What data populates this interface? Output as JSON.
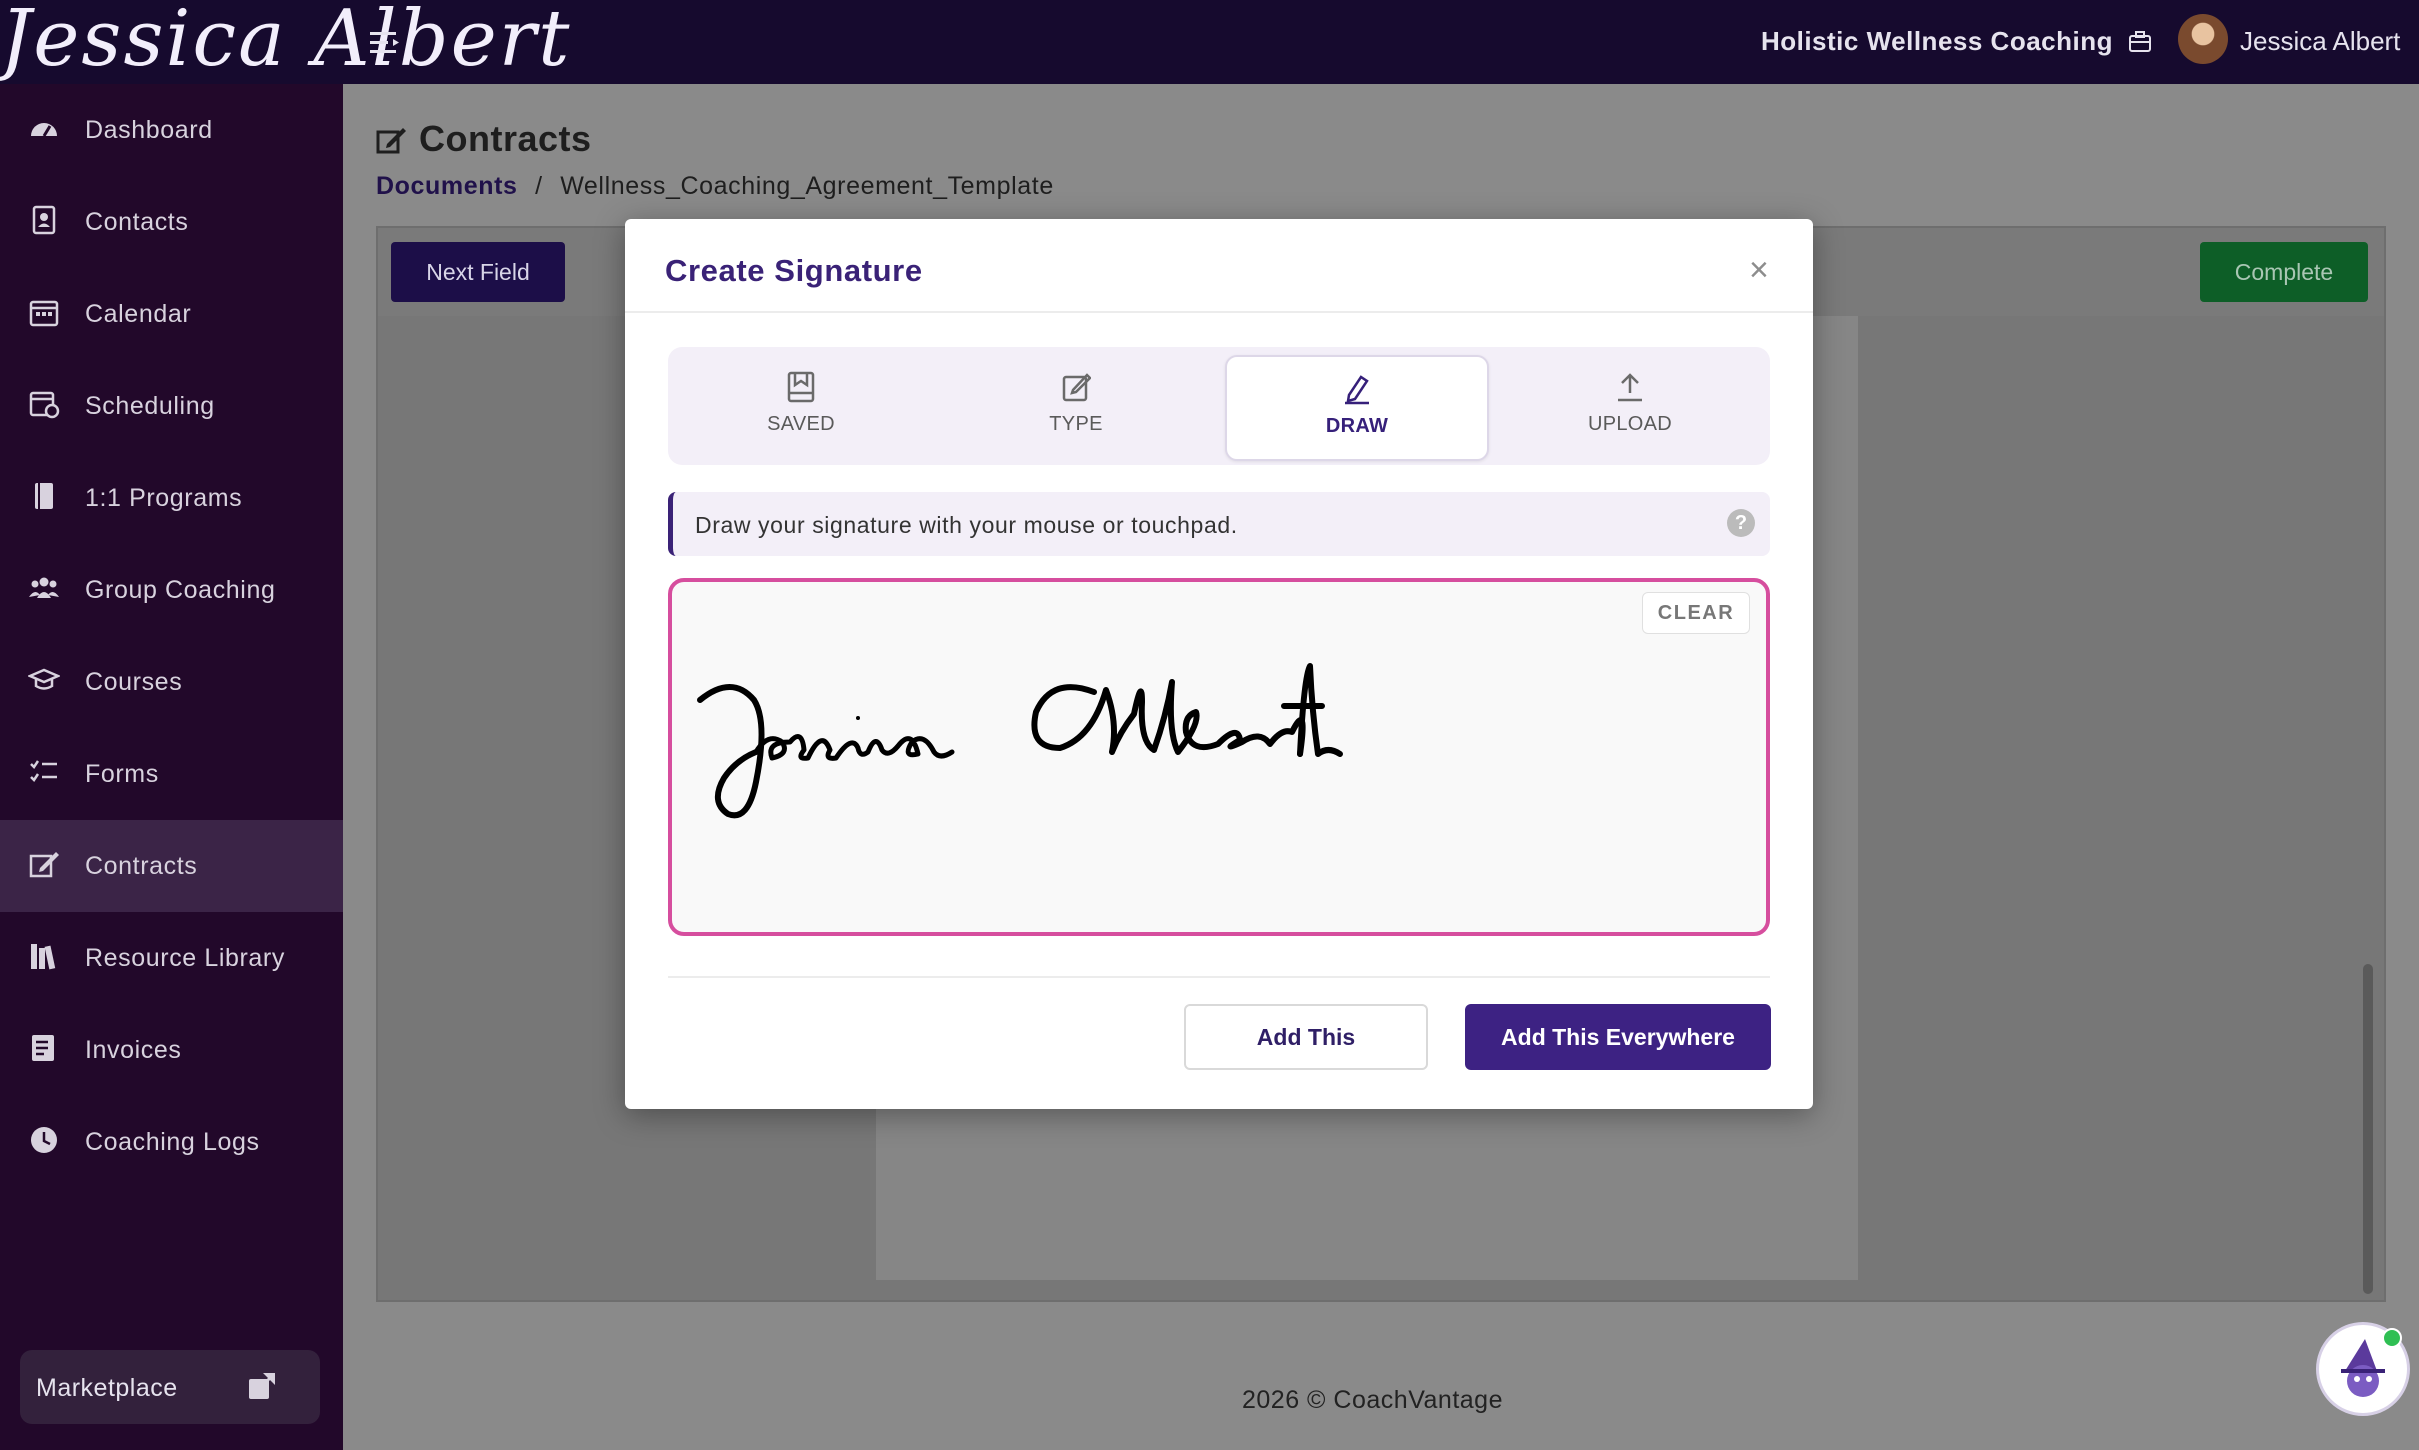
{
  "topbar": {
    "logo": "Jessica Albert",
    "business_name": "Holistic Wellness Coaching",
    "user_name": "Jessica Albert"
  },
  "sidebar": {
    "items": [
      {
        "label": "Dashboard",
        "icon": "dashboard-icon"
      },
      {
        "label": "Contacts",
        "icon": "contacts-icon"
      },
      {
        "label": "Calendar",
        "icon": "calendar-icon"
      },
      {
        "label": "Scheduling",
        "icon": "scheduling-icon"
      },
      {
        "label": "1:1 Programs",
        "icon": "book-icon"
      },
      {
        "label": "Group Coaching",
        "icon": "group-icon"
      },
      {
        "label": "Courses",
        "icon": "graduation-cap-icon"
      },
      {
        "label": "Forms",
        "icon": "list-icon"
      },
      {
        "label": "Contracts",
        "icon": "contract-icon",
        "active": true
      },
      {
        "label": "Resource Library",
        "icon": "library-icon"
      },
      {
        "label": "Invoices",
        "icon": "invoice-icon"
      },
      {
        "label": "Coaching Logs",
        "icon": "clock-icon"
      }
    ],
    "marketplace": "Marketplace"
  },
  "main": {
    "title": "Contracts",
    "breadcrumb": {
      "root": "Documents",
      "separator": "/",
      "current": "Wellness_Coaching_Agreement_Template"
    },
    "toolbar": {
      "next_field": "Next Field",
      "complete": "Complete"
    }
  },
  "footer": "2026 © CoachVantage",
  "modal": {
    "title": "Create Signature",
    "close": "×",
    "tabs": [
      {
        "label": "SAVED",
        "icon": "saved-icon"
      },
      {
        "label": "TYPE",
        "icon": "edit-icon"
      },
      {
        "label": "DRAW",
        "icon": "pen-icon",
        "active": true
      },
      {
        "label": "UPLOAD",
        "icon": "upload-icon"
      }
    ],
    "hint": "Draw your signature with your mouse or touchpad.",
    "help": "?",
    "clear": "CLEAR",
    "add_this": "Add This",
    "add_everywhere": "Add This Everywhere"
  },
  "colors": {
    "topbar": "#160a2e",
    "sidebar": "#22082a",
    "accent": "#3d2283",
    "canvas_border": "#d64e9e",
    "complete": "#0d5e27"
  }
}
